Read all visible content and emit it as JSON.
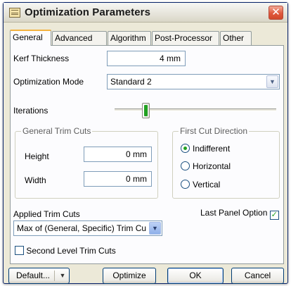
{
  "window": {
    "title": "Optimization Parameters",
    "close_glyph": "✕",
    "icon": "app-icon"
  },
  "tabs": [
    {
      "label": "General",
      "active": true
    },
    {
      "label": "Advanced",
      "active": false
    },
    {
      "label": "Algorithm",
      "active": false
    },
    {
      "label": "Post-Processor",
      "active": false
    },
    {
      "label": "Other",
      "active": false
    }
  ],
  "general": {
    "kerf_label": "Kerf Thickness",
    "kerf_value": "4 mm",
    "mode_label": "Optimization Mode",
    "mode_value": "Standard 2",
    "iterations_label": "Iterations",
    "iterations_level": 0.18,
    "trim_group": {
      "title": "General Trim Cuts",
      "height_label": "Height",
      "height_value": "0 mm",
      "width_label": "Width",
      "width_value": "0 mm"
    },
    "direction_group": {
      "title": "First Cut Direction",
      "options": [
        {
          "label": "Indifferent",
          "selected": true
        },
        {
          "label": "Horizontal",
          "selected": false
        },
        {
          "label": "Vertical",
          "selected": false
        }
      ]
    },
    "applied_label": "Applied Trim Cuts",
    "applied_value": "Max of (General, Specific) Trim Cu",
    "last_panel_label": "Last Panel Option",
    "last_panel_checked": true,
    "second_level_label": "Second Level Trim Cuts",
    "second_level_checked": false
  },
  "buttons": {
    "default_label": "Default...",
    "optimize_label": "Optimize",
    "ok_label": "OK",
    "cancel_label": "Cancel"
  },
  "colors": {
    "accent_green": "#21a121",
    "tab_highlight": "#f3b33f",
    "close_red": "#e0583c"
  }
}
